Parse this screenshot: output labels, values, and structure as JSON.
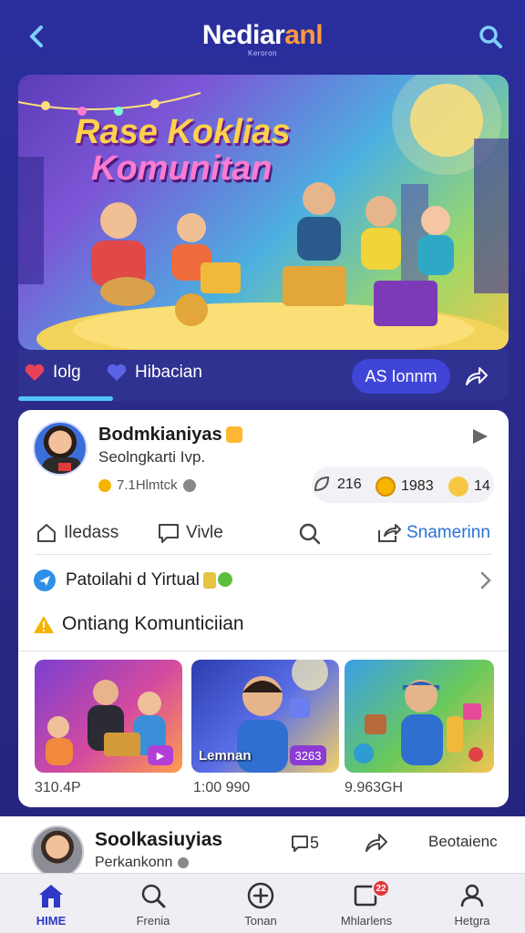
{
  "header": {
    "logo_white": "Nediar",
    "logo_orange": "anl",
    "logo_sub": "Keroron"
  },
  "hero": {
    "title_line1": "Rase Koklias",
    "title_line2": "Komunitan"
  },
  "tabs": {
    "tab1": "Iolg",
    "tab2": "Hibacian",
    "ask_button": "AS Ionnm"
  },
  "post": {
    "name": "Bodmkianiyas",
    "subtitle": "Seolngkarti Ivp.",
    "meta": "7.1Hlmtck",
    "stat_a": "216",
    "stat_b": "1983",
    "stat_c": "14",
    "actions": {
      "like": "Iledass",
      "comment": "Vivle",
      "share": "Snamerinn"
    },
    "virtual_row": "Patoilahi d Yirtual",
    "komun_row": "Ontiang Komunticiian",
    "thumbs": [
      {
        "label": "",
        "badge": "",
        "caption": "310.4P"
      },
      {
        "label": "Lemnan",
        "badge": "3263",
        "caption": "1:00 990"
      },
      {
        "label": "",
        "badge": "",
        "caption": "9.963GH"
      }
    ]
  },
  "post2": {
    "name": "Soolkasiuyias",
    "subtitle": "Perkankonn",
    "comments": "5",
    "more": "Beotaienc"
  },
  "nav": {
    "home": "HIME",
    "search": "Frenia",
    "add": "Tonan",
    "messages": "Mhlarlens",
    "messages_badge": "22",
    "profile": "Hetgra"
  },
  "colors": {
    "accent": "#2f37c7",
    "background": "#2a2f9e",
    "link": "#2a72d8"
  }
}
